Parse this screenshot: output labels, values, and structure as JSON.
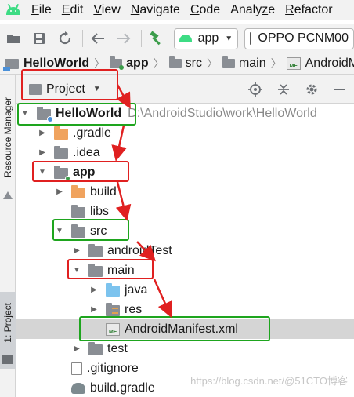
{
  "menu": {
    "items": [
      "File",
      "Edit",
      "View",
      "Navigate",
      "Code",
      "Analyze",
      "Refactor"
    ],
    "mnemonics": [
      "F",
      "E",
      "V",
      "N",
      "C",
      "z",
      "R"
    ]
  },
  "toolbar": {
    "run_config": "app",
    "device": "OPPO PCNM00",
    "icons": [
      "folder-open-icon",
      "save-icon",
      "sync-icon",
      "back-arrow-icon",
      "forward-arrow-icon",
      "hammer-icon"
    ]
  },
  "breadcrumb": [
    {
      "label": "HelloWorld",
      "bold": true,
      "icon": "project-icon"
    },
    {
      "label": "app",
      "bold": true,
      "icon": "module-icon"
    },
    {
      "label": "src",
      "bold": false,
      "icon": "folder-icon"
    },
    {
      "label": "main",
      "bold": false,
      "icon": "folder-icon"
    },
    {
      "label": "AndroidManifest.xml",
      "bold": false,
      "icon": "manifest-icon"
    }
  ],
  "left_strip": {
    "resource_manager": "Resource Manager",
    "project_tab": "1: Project"
  },
  "project_panel": {
    "title": "Project",
    "header_icons": [
      "locate-icon",
      "collapse-all-icon",
      "gear-icon",
      "minimize-icon"
    ]
  },
  "tree": [
    {
      "label": "HelloWorld",
      "path": "D:\\AndroidStudio\\work\\HelloWorld",
      "bold": true,
      "expanded": true,
      "icon": "project-folder",
      "level": 0
    },
    {
      "label": ".gradle",
      "expanded": false,
      "icon": "folder-orange",
      "level": 1
    },
    {
      "label": ".idea",
      "expanded": false,
      "icon": "folder-gray",
      "level": 1
    },
    {
      "label": "app",
      "bold": true,
      "expanded": true,
      "icon": "module-folder",
      "level": 1
    },
    {
      "label": "build",
      "expanded": false,
      "icon": "folder-orange",
      "level": 2
    },
    {
      "label": "libs",
      "leaf": true,
      "icon": "folder-gray",
      "level": 2
    },
    {
      "label": "src",
      "expanded": true,
      "icon": "folder-gray",
      "level": 2
    },
    {
      "label": "androidTest",
      "expanded": false,
      "icon": "folder-gray",
      "level": 3
    },
    {
      "label": "main",
      "expanded": true,
      "icon": "folder-gray",
      "level": 3
    },
    {
      "label": "java",
      "expanded": false,
      "icon": "folder-blue",
      "level": 4
    },
    {
      "label": "res",
      "expanded": false,
      "icon": "folder-res",
      "level": 4
    },
    {
      "label": "AndroidManifest.xml",
      "leaf": true,
      "icon": "manifest-file",
      "level": 4,
      "selected": true
    },
    {
      "label": "test",
      "expanded": false,
      "icon": "folder-gray",
      "level": 3
    },
    {
      "label": ".gitignore",
      "leaf": true,
      "icon": "gitignore-file",
      "level": 2
    },
    {
      "label": "build.gradle",
      "leaf": true,
      "icon": "gradle-file",
      "level": 2
    }
  ],
  "watermark": "https://blog.csdn.net/@51CTO博客",
  "colors": {
    "annotation_red": "#e02020",
    "annotation_green": "#1ea51e",
    "selection": "#d5d5d5",
    "folder_orange": "#f0a35e",
    "folder_blue": "#7cc3ee",
    "android_green": "#3ddc84"
  }
}
